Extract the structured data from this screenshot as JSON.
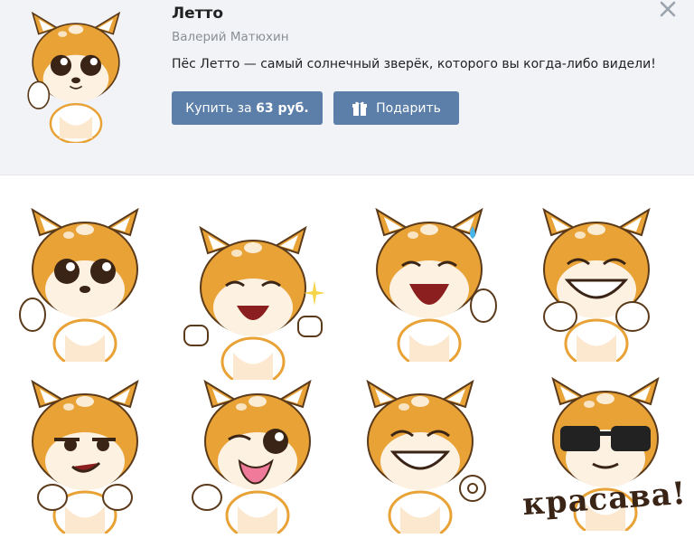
{
  "pack": {
    "title": "Летто",
    "author": "Валерий Матюхин",
    "description": "Пёс Летто — самый солнечный зверёк, которого вы когда-либо видели!"
  },
  "buttons": {
    "buy_prefix": "Купить за ",
    "buy_price": "63 руб.",
    "gift_label": "Подарить"
  },
  "icons": {
    "close": "close-icon",
    "gift": "gift-icon"
  },
  "colors": {
    "header_bg": "#f1f3f6",
    "button_bg": "#5b7fa8",
    "fur": "#e8a236",
    "fur_light": "#fce8cf"
  },
  "stickers": [
    {
      "name": "shy"
    },
    {
      "name": "laughing-thumbs-up"
    },
    {
      "name": "laughing-sweat"
    },
    {
      "name": "grinning-fists"
    },
    {
      "name": "smirk-pointing"
    },
    {
      "name": "winking-tongue"
    },
    {
      "name": "ok-gesture"
    },
    {
      "name": "sunglasses-krasava",
      "caption": "красава!"
    }
  ]
}
